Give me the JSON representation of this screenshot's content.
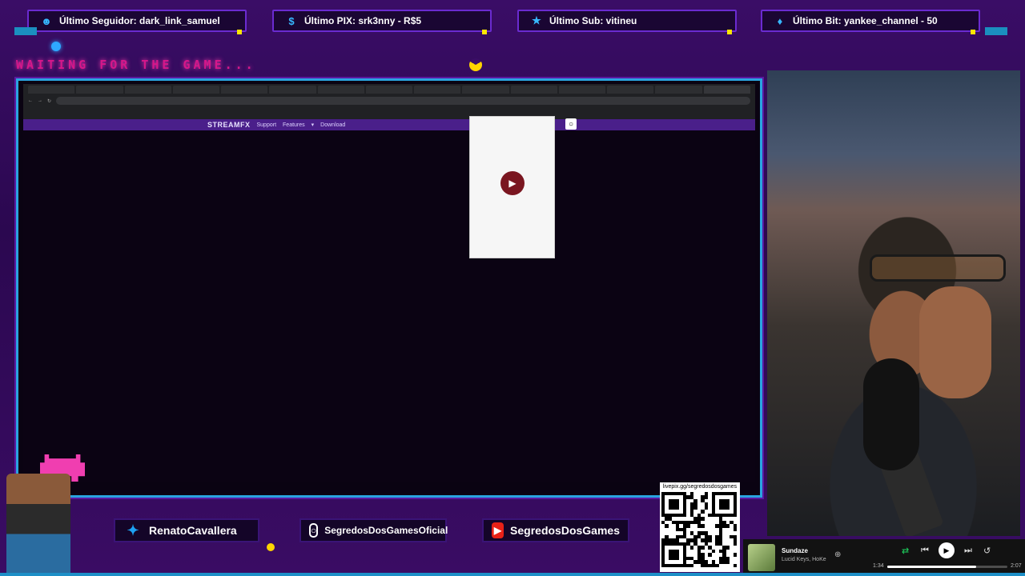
{
  "alerts": {
    "follower": "Último Seguidor: dark_link_samuel",
    "pix": "Último PIX: srk3nny - R$5",
    "sub": "Último Sub: vitineu",
    "bit": "Último Bit: yankee_channel - 50"
  },
  "waiting_text": "WAITING FOR THE GAME...",
  "browser": {
    "site_logo": "STREAMFX",
    "nav_support": "Support",
    "nav_features": "Features",
    "nav_download": "Download"
  },
  "socials": {
    "twitter": "RenatoCavallera",
    "instagram": "SegredosDosGamesOficial",
    "youtube": "SegredosDosGames"
  },
  "qr_label": "livepix.gg/segredosdosgames",
  "player": {
    "song": "Sundaze",
    "artist": "Lucid Keys, HoKe",
    "elapsed": "1:34",
    "total": "2:07",
    "progress": 0.74
  },
  "colors": {
    "accent_blue": "#2aa4e0",
    "accent_pink": "#d6178a",
    "accent_yellow": "#ffd400"
  }
}
